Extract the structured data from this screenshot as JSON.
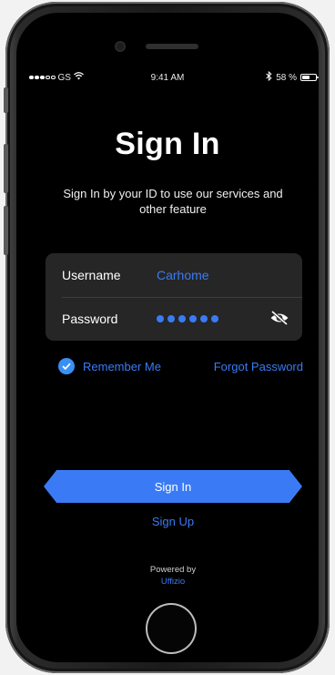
{
  "status_bar": {
    "carrier": "GS",
    "time": "9:41 AM",
    "battery_percent": "58 %",
    "battery_level": 0.58,
    "signal_bars": 3
  },
  "page": {
    "title": "Sign In",
    "subtitle": "Sign In by your ID to use our services and other feature"
  },
  "form": {
    "username_label": "Username",
    "username_value": "Carhome",
    "password_label": "Password",
    "password_length": 6
  },
  "options": {
    "remember_label": "Remember Me",
    "remember_checked": true,
    "forgot_label": "Forgot Password"
  },
  "actions": {
    "signin_label": "Sign In",
    "signup_label": "Sign Up"
  },
  "footer": {
    "powered_label": "Powered by",
    "brand": "Uffizio"
  },
  "colors": {
    "accent": "#3a7bf5",
    "background": "#000000",
    "card": "#262626"
  },
  "icons": {
    "wifi": "wifi-icon",
    "bluetooth": "bluetooth-icon",
    "battery": "battery-icon",
    "eye": "eye-slash-icon",
    "check": "checkmark-icon"
  }
}
